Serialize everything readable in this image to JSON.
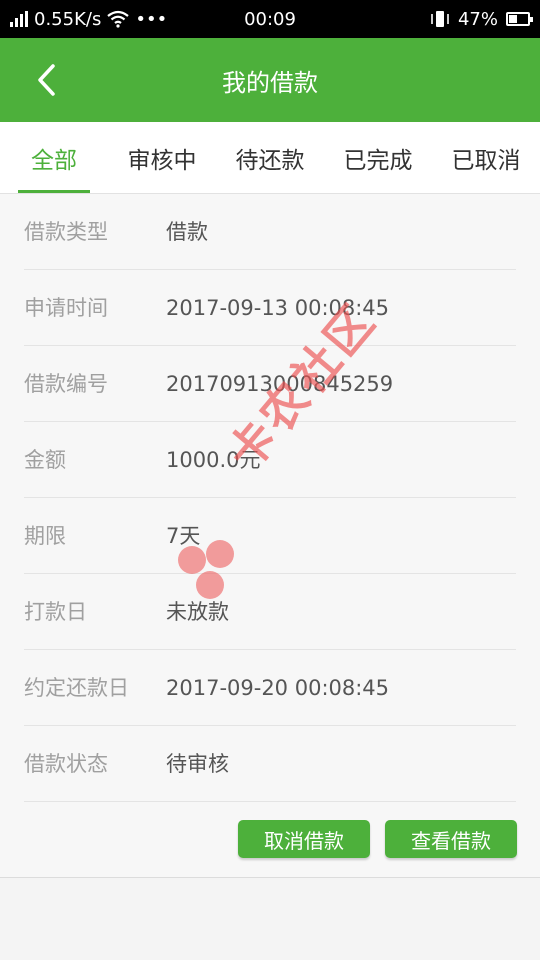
{
  "status_bar": {
    "network_speed": "0.55K/s",
    "more": "•••",
    "time": "00:09",
    "battery": "47%",
    "battery_level": 0.47
  },
  "header": {
    "title": "我的借款",
    "back_icon": "chevron-left-icon"
  },
  "tabs": [
    {
      "label": "全部",
      "active": true
    },
    {
      "label": "审核中",
      "active": false
    },
    {
      "label": "待还款",
      "active": false
    },
    {
      "label": "已完成",
      "active": false
    },
    {
      "label": "已取消",
      "active": false
    }
  ],
  "loan": {
    "rows": [
      {
        "label": "借款类型",
        "value": "借款"
      },
      {
        "label": "申请时间",
        "value": "2017-09-13 00:08:45"
      },
      {
        "label": "借款编号",
        "value": "20170913000845259"
      },
      {
        "label": "金额",
        "value": "1000.0元"
      },
      {
        "label": "期限",
        "value": "7天"
      },
      {
        "label": "打款日",
        "value": "未放款"
      },
      {
        "label": "约定还款日",
        "value": "2017-09-20 00:08:45"
      },
      {
        "label": "借款状态",
        "value": "待审核"
      }
    ],
    "cancel_label": "取消借款",
    "view_label": "查看借款"
  },
  "watermark": {
    "text": "卡农社区"
  },
  "colors": {
    "primary": "#4db03b",
    "watermark": "#ec5050"
  }
}
